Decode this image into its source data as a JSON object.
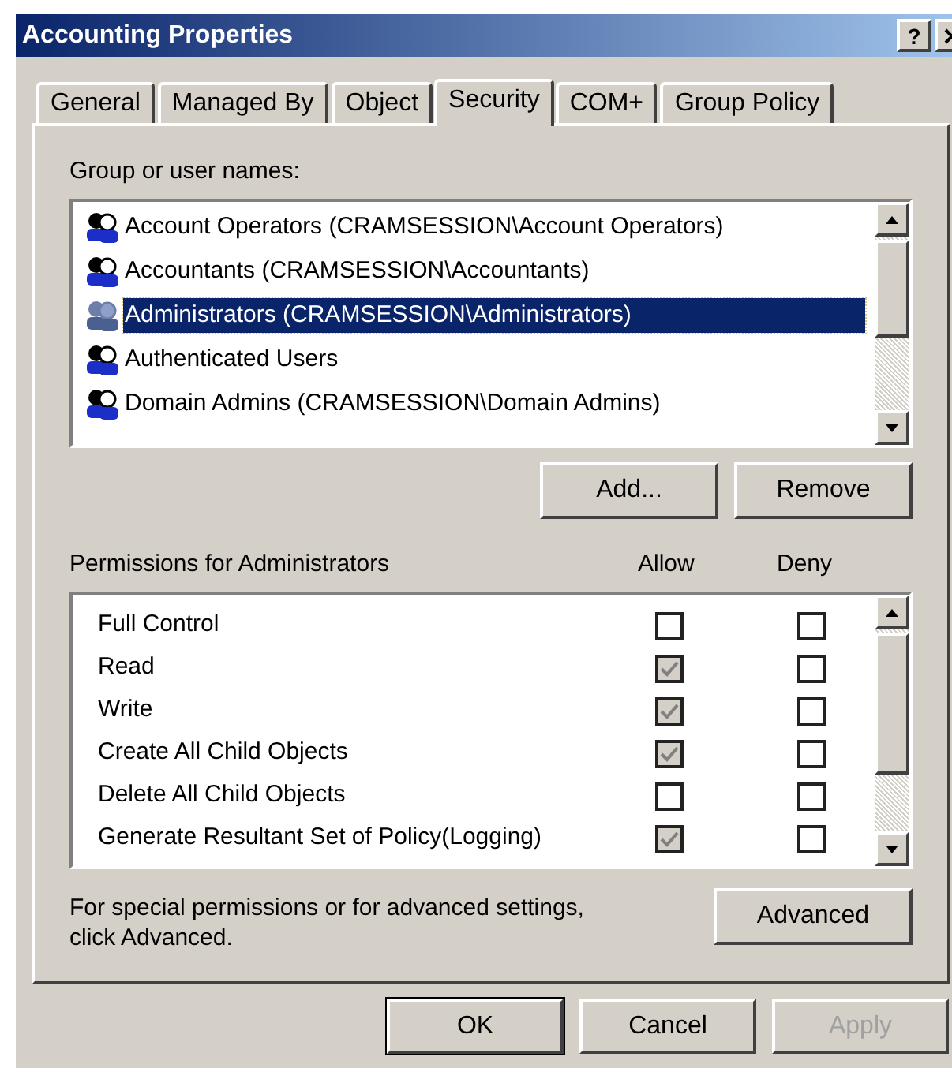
{
  "window": {
    "title": "Accounting Properties",
    "help_button": "?"
  },
  "tabs": [
    {
      "label": "General",
      "selected": false
    },
    {
      "label": "Managed By",
      "selected": false
    },
    {
      "label": "Object",
      "selected": false
    },
    {
      "label": "Security",
      "selected": true
    },
    {
      "label": "COM+",
      "selected": false
    },
    {
      "label": "Group Policy",
      "selected": false
    }
  ],
  "groups": {
    "label": "Group or user names:",
    "items": [
      {
        "name": "Account Operators (CRAMSESSION\\Account Operators)",
        "selected": false
      },
      {
        "name": "Accountants (CRAMSESSION\\Accountants)",
        "selected": false
      },
      {
        "name": "Administrators (CRAMSESSION\\Administrators)",
        "selected": true
      },
      {
        "name": "Authenticated Users",
        "selected": false
      },
      {
        "name": "Domain Admins (CRAMSESSION\\Domain Admins)",
        "selected": false
      }
    ],
    "buttons": [
      "Add...",
      "Remove"
    ]
  },
  "permissions": {
    "label": "Permissions for Administrators",
    "allow_header": "Allow",
    "deny_header": "Deny",
    "rows": [
      {
        "name": "Full Control",
        "allow": false,
        "deny": false
      },
      {
        "name": "Read",
        "allow": true,
        "deny": false
      },
      {
        "name": "Write",
        "allow": true,
        "deny": false
      },
      {
        "name": "Create All Child Objects",
        "allow": true,
        "deny": false
      },
      {
        "name": "Delete All Child Objects",
        "allow": false,
        "deny": false
      },
      {
        "name": "Generate Resultant Set of Policy(Logging)",
        "allow": true,
        "deny": false
      }
    ]
  },
  "advanced": {
    "note": "For special permissions or for advanced settings, click Advanced.",
    "button": "Advanced"
  },
  "footer_buttons": [
    {
      "label": "OK",
      "default": true,
      "disabled": false
    },
    {
      "label": "Cancel",
      "default": false,
      "disabled": false
    },
    {
      "label": "Apply",
      "default": false,
      "disabled": true
    }
  ]
}
